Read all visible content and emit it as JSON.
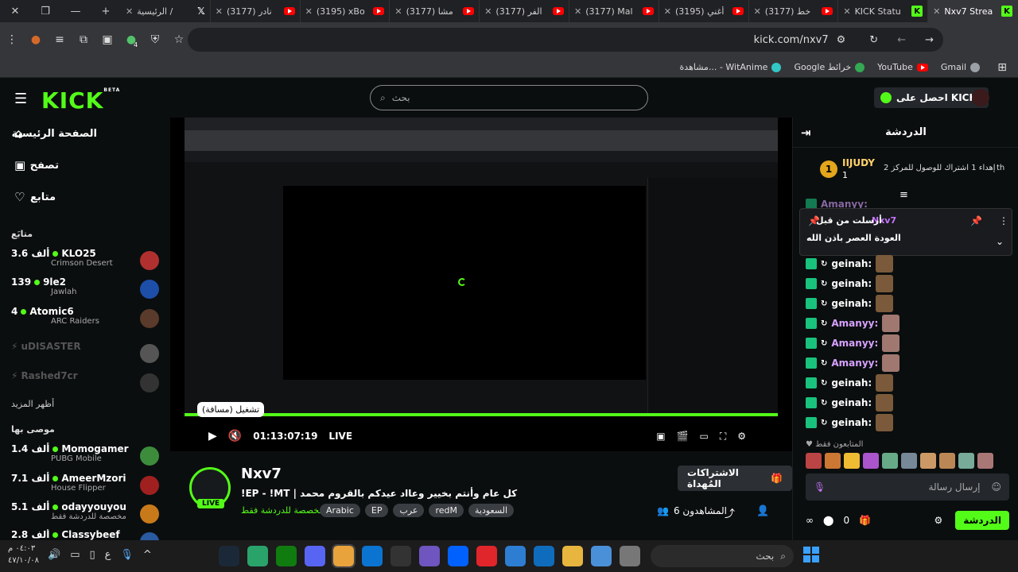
{
  "browser": {
    "tabs": [
      {
        "label": "الرئيسية /",
        "icon": "x-logo-icon"
      },
      {
        "label": "(3177) نادر",
        "icon": "youtube-icon"
      },
      {
        "label": "(3195) xBo",
        "icon": "youtube-icon"
      },
      {
        "label": "(3177) مشا",
        "icon": "youtube-icon"
      },
      {
        "label": "(3177) الفر",
        "icon": "youtube-icon"
      },
      {
        "label": "(3177) Mal",
        "icon": "youtube-icon"
      },
      {
        "label": "(3195) أغني",
        "icon": "youtube-icon"
      },
      {
        "label": "(3177) خط",
        "icon": "youtube-icon"
      },
      {
        "label": "KICK Statu",
        "icon": "kick-icon"
      },
      {
        "label": "Nxv7 Strea",
        "icon": "kick-icon"
      }
    ],
    "url": "kick.com/nxv7",
    "extension_count": "4",
    "bookmarks": [
      "Gmail",
      "YouTube",
      "Google خرائط",
      "مشاهدة... - WitAnime"
    ]
  },
  "header": {
    "logo": "KICK",
    "logo_beta": "BETA",
    "search_placeholder": "بحث",
    "get_kicks": "احصل على KICKs"
  },
  "sidebar": {
    "nav": [
      {
        "label": "الصفحة الرئيسية",
        "icon": "home-icon"
      },
      {
        "label": "تصفح",
        "icon": "browse-icon"
      },
      {
        "label": "متابع",
        "icon": "heart-icon"
      }
    ],
    "following_title": "متابَع",
    "following": [
      {
        "name": "KLO25",
        "viewers": "3.6 ألف",
        "game": "Crimson Desert",
        "live": true,
        "avatar_color": "#b03030"
      },
      {
        "name": "9le2",
        "viewers": "139",
        "game": "Jawlah",
        "live": true,
        "avatar_color": "#1d4ea8"
      },
      {
        "name": "Atomic6",
        "viewers": "4",
        "game": "ARC Raiders",
        "live": true,
        "avatar_color": "#5a3a2a"
      },
      {
        "name": "uDISASTER",
        "viewers": "",
        "game": "",
        "live": false,
        "avatar_color": "#555555"
      },
      {
        "name": "Rashed7cr",
        "viewers": "",
        "game": "",
        "live": false,
        "avatar_color": "#333333"
      }
    ],
    "show_more": "أظهر المزيد",
    "recommended_title": "موصى بها",
    "recommended": [
      {
        "name": "Momogamer",
        "viewers": "1.4 ألف",
        "game": "PUBG Mobile",
        "avatar_color": "#3c8c3c"
      },
      {
        "name": "AmeerMzori",
        "viewers": "7.1 ألف",
        "game": "House Flipper",
        "avatar_color": "#a02020"
      },
      {
        "name": "odayyouyou",
        "viewers": "5.1 ألف",
        "game": "مخصصة للدردشة فقط",
        "avatar_color": "#c87a1a"
      },
      {
        "name": "Classybeef",
        "viewers": "2.8 ألف",
        "game": "",
        "avatar_color": "#2a5aa0"
      }
    ]
  },
  "player": {
    "time": "01:13:07:19",
    "live_label": "LIVE",
    "tooltip": "تشغيل (مسافة)",
    "progress_fraction": 1.0
  },
  "stream": {
    "streamer": "Nxv7",
    "title": "!EP - !MT | كل عام وأنتم بخيير وعااد عيدكم بالقروم محمد",
    "category": "مخصصة للدردشة فقط",
    "tags": [
      "Arabic",
      "EP",
      "عرب",
      "redM",
      "السعودية"
    ],
    "gift_button": "الاشتراكات المُهداة",
    "viewers": "6 المشاهدون",
    "live": "LIVE"
  },
  "chat": {
    "title": "الدردشة",
    "leaderboard_user": "IIJUDY",
    "leaderboard_rank": "1",
    "leaderboard_count": "1",
    "leaderboard_goal": "إهداء 1 اشتراك للوصول للمركز 2",
    "leaderboard_goal_user": "th",
    "pinned_by_label": "أرسلت من قبل",
    "pinned_by_user": "Nxv7",
    "pinned_text": "العودة العصر باذن الله",
    "messages": [
      {
        "user": "Amanyy:",
        "color": "#d7a2ff"
      },
      {
        "user": "geinah:",
        "color": "#ffffff"
      },
      {
        "user": "geinah:",
        "color": "#ffffff"
      },
      {
        "user": "geinah:",
        "color": "#ffffff"
      },
      {
        "user": "Amanyy:",
        "color": "#d7a2ff"
      },
      {
        "user": "Amanyy:",
        "color": "#d7a2ff"
      },
      {
        "user": "Amanyy:",
        "color": "#d7a2ff"
      },
      {
        "user": "geinah:",
        "color": "#ffffff"
      },
      {
        "user": "geinah:",
        "color": "#ffffff"
      },
      {
        "user": "geinah:",
        "color": "#ffffff"
      }
    ],
    "supporters_label": "المتابعون فقط",
    "input_placeholder": "إرسال رسالة",
    "footer_count": "0",
    "chat_button": "الدردشة"
  },
  "taskbar": {
    "time": "٠٤:٠٣ م",
    "date": "٤٧/١٠/٠٨",
    "search_placeholder": "بحث",
    "lang": "ع"
  },
  "colors": {
    "accent": "#53fc18",
    "background": "#0b0e0f"
  }
}
